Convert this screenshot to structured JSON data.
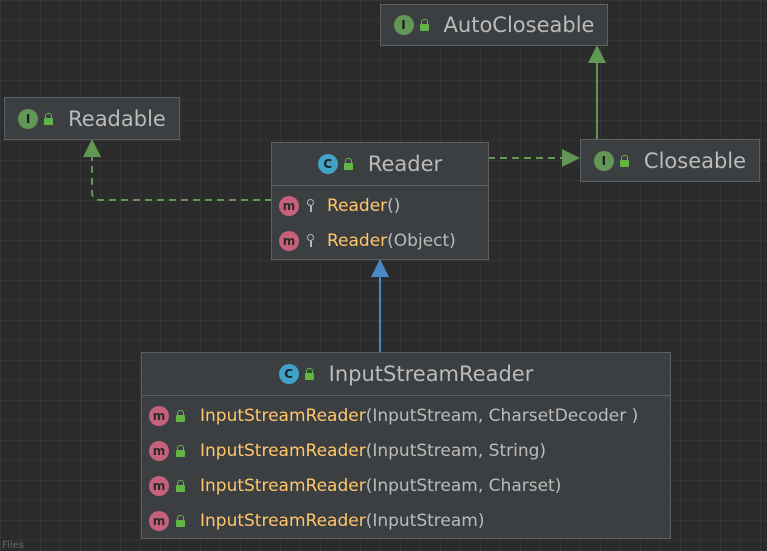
{
  "nodes": {
    "autocloseable": {
      "kind": "interface",
      "kind_letter": "I",
      "name": "AutoCloseable"
    },
    "readable": {
      "kind": "interface",
      "kind_letter": "I",
      "name": "Readable"
    },
    "closeable": {
      "kind": "interface",
      "kind_letter": "I",
      "name": "Closeable"
    },
    "reader": {
      "kind": "abstract-class",
      "kind_letter": "C",
      "name": "Reader",
      "members": [
        {
          "name": "Reader",
          "params": "()",
          "visibility": "protected"
        },
        {
          "name": "Reader",
          "params": "(Object)",
          "visibility": "protected"
        }
      ]
    },
    "inputstreamreader": {
      "kind": "class",
      "kind_letter": "C",
      "name": "InputStreamReader",
      "members": [
        {
          "name": "InputStreamReader",
          "params": "(InputStream, CharsetDecoder )",
          "visibility": "public"
        },
        {
          "name": "InputStreamReader",
          "params": "(InputStream, String)",
          "visibility": "public"
        },
        {
          "name": "InputStreamReader",
          "params": "(InputStream, Charset)",
          "visibility": "public"
        },
        {
          "name": "InputStreamReader",
          "params": "(InputStream)",
          "visibility": "public"
        }
      ]
    }
  },
  "member_badge": "m",
  "edges": [
    {
      "from": "closeable",
      "to": "autocloseable",
      "type": "extends",
      "style": "solid"
    },
    {
      "from": "reader",
      "to": "closeable",
      "type": "implements",
      "style": "dashed"
    },
    {
      "from": "reader",
      "to": "readable",
      "type": "implements",
      "style": "dashed"
    },
    {
      "from": "inputstreamreader",
      "to": "reader",
      "type": "extends",
      "style": "solid"
    }
  ],
  "colors": {
    "background": "#2b2b2b",
    "node_fill": "#3c3f41",
    "interface_edge": "#629755",
    "class_edge": "#4a88c7",
    "interface_badge": "#629755",
    "class_badge": "#40a2c6",
    "method_badge": "#c7607a",
    "method_name": "#ffc66d"
  },
  "footer_partial": "Files"
}
